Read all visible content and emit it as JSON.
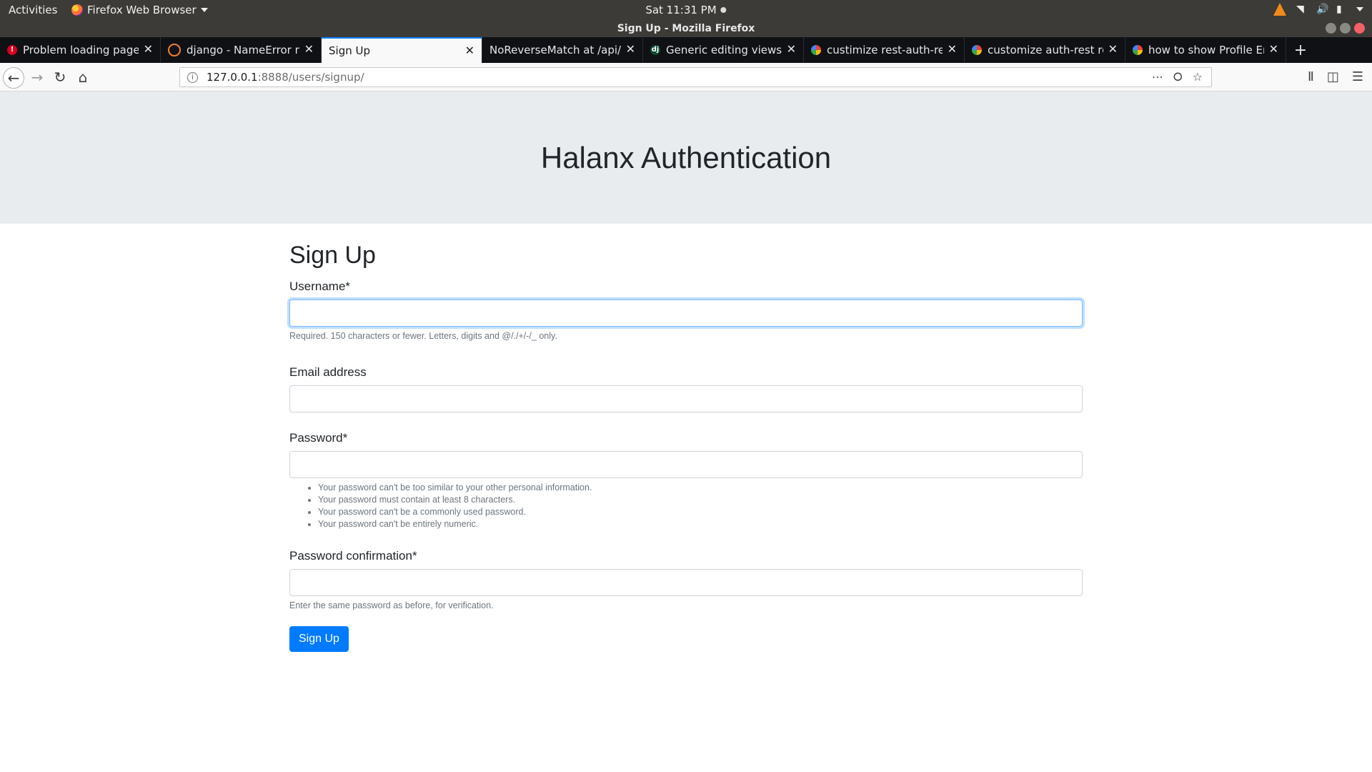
{
  "system": {
    "activities": "Activities",
    "app_menu": "Firefox Web Browser",
    "clock": "Sat 11:31 PM"
  },
  "window": {
    "title": "Sign Up - Mozilla Firefox"
  },
  "tabs": [
    {
      "title": "Problem loading page",
      "favicon": "error-icon"
    },
    {
      "title": "django - NameError nam",
      "favicon": "stackoverflow-icon"
    },
    {
      "title": "Sign Up",
      "favicon": "none",
      "active": true
    },
    {
      "title": "NoReverseMatch at /api/re",
      "favicon": "none"
    },
    {
      "title": "Generic editing views | Dj",
      "favicon": "django-icon"
    },
    {
      "title": "custimize rest-auth-regis",
      "favicon": "google-icon"
    },
    {
      "title": "customize auth-rest regi",
      "favicon": "google-icon"
    },
    {
      "title": "how to show Profile Ema",
      "favicon": "google-icon"
    }
  ],
  "url": {
    "host": "127.0.0.1",
    "path": ":8888/users/signup/"
  },
  "page": {
    "jumbotron_title": "Halanx Authentication",
    "heading": "Sign Up",
    "fields": {
      "username": {
        "label": "Username*",
        "value": "",
        "help": "Required. 150 characters or fewer. Letters, digits and @/./+/-/_ only."
      },
      "email": {
        "label": "Email address",
        "value": ""
      },
      "password": {
        "label": "Password*",
        "value": "",
        "help_items": [
          "Your password can't be too similar to your other personal information.",
          "Your password must contain at least 8 characters.",
          "Your password can't be a commonly used password.",
          "Your password can't be entirely numeric."
        ]
      },
      "password_confirm": {
        "label": "Password confirmation*",
        "value": "",
        "help": "Enter the same password as before, for verification."
      }
    },
    "submit_label": "Sign Up"
  },
  "colors": {
    "primary": "#007bff",
    "jumbotron_bg": "#e9ecef",
    "active_tab_accent": "#0a84ff"
  }
}
